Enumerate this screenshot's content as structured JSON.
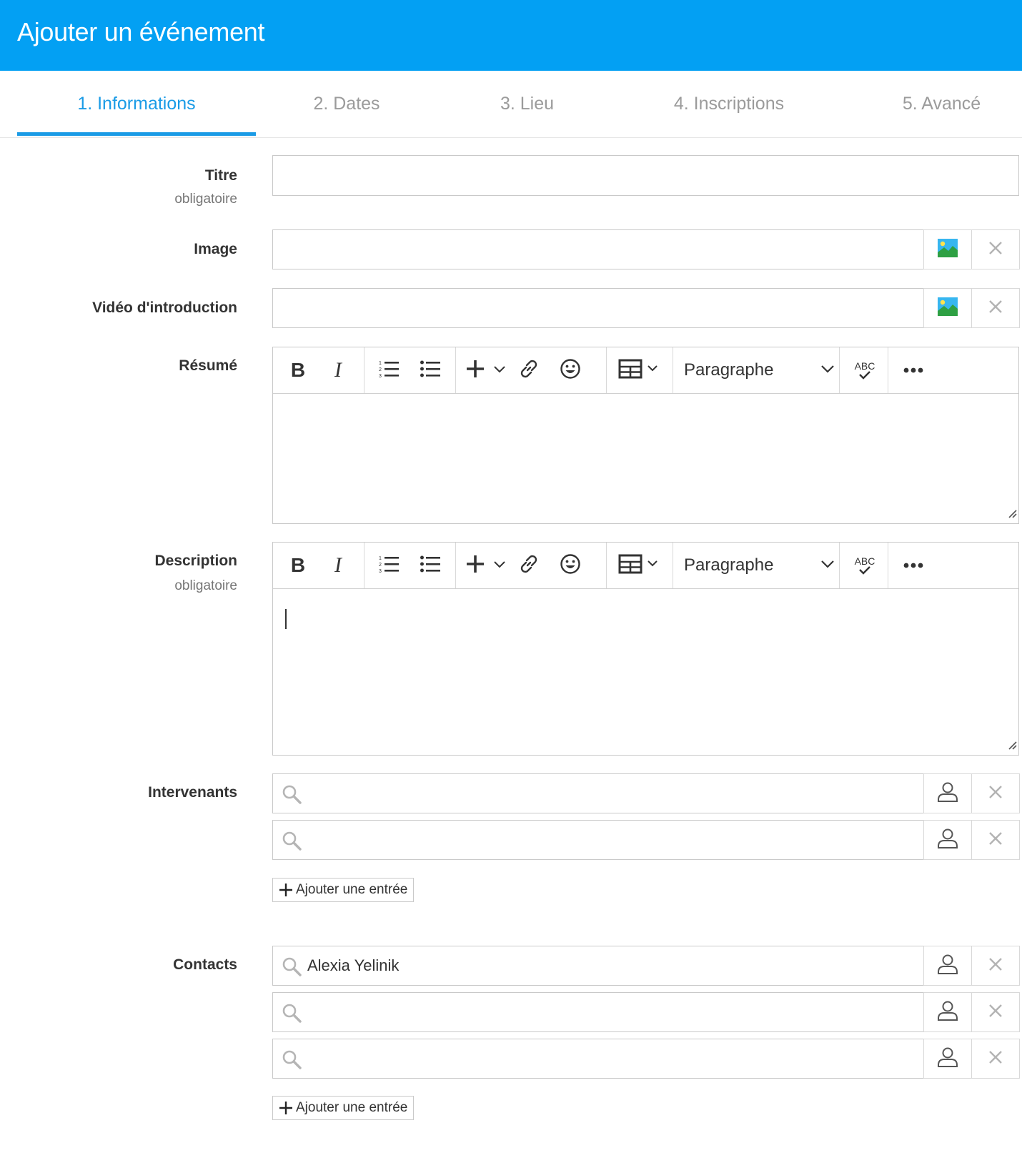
{
  "header": {
    "title": "Ajouter un événement"
  },
  "tabs": [
    {
      "label": "1. Informations"
    },
    {
      "label": "2. Dates"
    },
    {
      "label": "3. Lieu"
    },
    {
      "label": "4. Inscriptions"
    },
    {
      "label": "5. Avancé"
    }
  ],
  "form": {
    "titre": {
      "label": "Titre",
      "required": "obligatoire",
      "value": ""
    },
    "image": {
      "label": "Image",
      "value": ""
    },
    "video": {
      "label": "Vidéo d'introduction",
      "value": ""
    },
    "resume": {
      "label": "Résumé",
      "value": ""
    },
    "description": {
      "label": "Description",
      "required": "obligatoire",
      "value": ""
    },
    "intervenants": {
      "label": "Intervenants",
      "entries": [
        "",
        ""
      ],
      "add_label": "Ajouter une entrée"
    },
    "contacts": {
      "label": "Contacts",
      "entries": [
        "Alexia Yelinik",
        "",
        ""
      ],
      "add_label": "Ajouter une entrée"
    }
  },
  "editor_toolbar": {
    "bold": "B",
    "italic": "I",
    "format_select": "Paragraphe",
    "spellcheck": "ABC",
    "icons": [
      "bold-icon",
      "italic-icon",
      "ordered-list-icon",
      "bullet-list-icon",
      "insert-plus-icon",
      "chevron-down-icon",
      "link-icon",
      "emoji-icon",
      "table-icon",
      "spellcheck-icon",
      "more-icon"
    ]
  },
  "colors": {
    "header_bg": "#03a0f3",
    "active_tab": "#1a9be6",
    "inactive_tab": "#9b9b9b",
    "border": "#c9c9c9"
  }
}
